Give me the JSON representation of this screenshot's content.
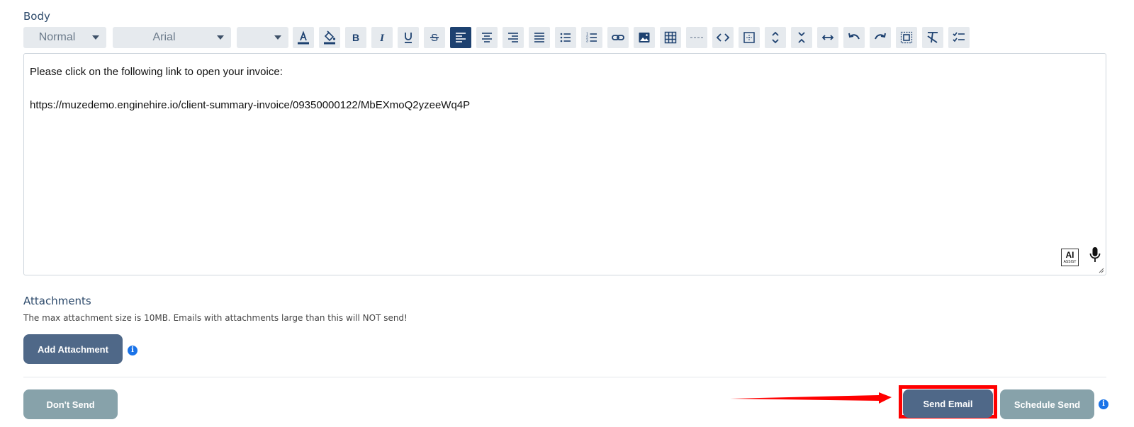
{
  "body_section": {
    "label": "Body",
    "toolbar": {
      "format_dropdown": "Normal",
      "font_dropdown": "Arial",
      "size_dropdown": "",
      "buttons": [
        "font-color",
        "background-color",
        "bold",
        "italic",
        "underline",
        "strikethrough",
        "align-left",
        "align-center",
        "align-right",
        "align-justify",
        "bullet-list",
        "numbered-list",
        "link",
        "image",
        "table",
        "horizontal-rule",
        "code-view",
        "select-all",
        "expand-vertical",
        "collapse-vertical",
        "expand-horizontal",
        "undo",
        "redo",
        "show-blocks",
        "remove-format",
        "checklist"
      ],
      "active_button": "align-left"
    },
    "editor": {
      "line1": "Please click on the following link to open your invoice:",
      "line2": "https://muzedemo.enginehire.io/client-summary-invoice/09350000122/MbEXmoQ2yzeeWq4P",
      "ai_assist_big": "AI",
      "ai_assist_small": "ASSIST"
    }
  },
  "attachments_section": {
    "label": "Attachments",
    "note": "The max attachment size is 10MB. Emails with attachments large than this will NOT send!",
    "add_button": "Add Attachment",
    "info_glyph": "i"
  },
  "footer": {
    "dont_send": "Don't Send",
    "send_email": "Send Email",
    "schedule_send": "Schedule Send"
  },
  "colors": {
    "primary": "#4f6888",
    "secondary": "#87a2aa",
    "info": "#1a73e8",
    "highlight": "#ff0000",
    "toolbar_active": "#1d4170"
  }
}
